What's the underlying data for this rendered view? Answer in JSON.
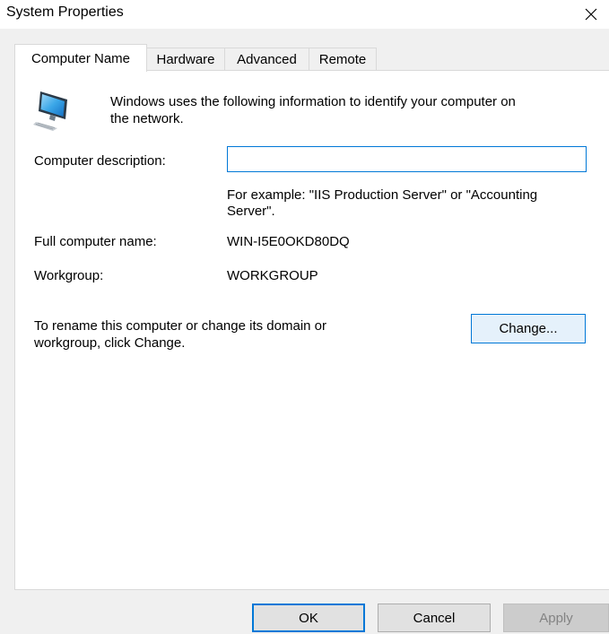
{
  "window": {
    "title": "System Properties",
    "close_glyph": "✕"
  },
  "tabs": [
    {
      "label": "Computer Name",
      "active": true
    },
    {
      "label": "Hardware",
      "active": false
    },
    {
      "label": "Advanced",
      "active": false
    },
    {
      "label": "Remote",
      "active": false
    }
  ],
  "computer_name": {
    "icon": "computer-icon",
    "intro_line1": "Windows uses the following information to identify your computer on",
    "intro_line2": "the network.",
    "description_label": "Computer description:",
    "description_value": "",
    "example_line1": "For example: \"IIS Production Server\" or \"Accounting",
    "example_line2": "Server\".",
    "full_name_label": "Full computer name:",
    "full_name_value": "WIN-I5E0OKD80DQ",
    "workgroup_label": "Workgroup:",
    "workgroup_value": "WORKGROUP",
    "rename_line1": "To rename this computer or change its domain or",
    "rename_line2": "workgroup, click Change.",
    "change_button": "Change..."
  },
  "footer": {
    "ok_label": "OK",
    "cancel_label": "Cancel",
    "apply_label": "Apply"
  },
  "colors": {
    "accent": "#0078d7",
    "dialog_background": "#f0f0f0",
    "panel_background": "#ffffff",
    "button_face": "#e1e1e1",
    "disabled_text": "#838383"
  }
}
